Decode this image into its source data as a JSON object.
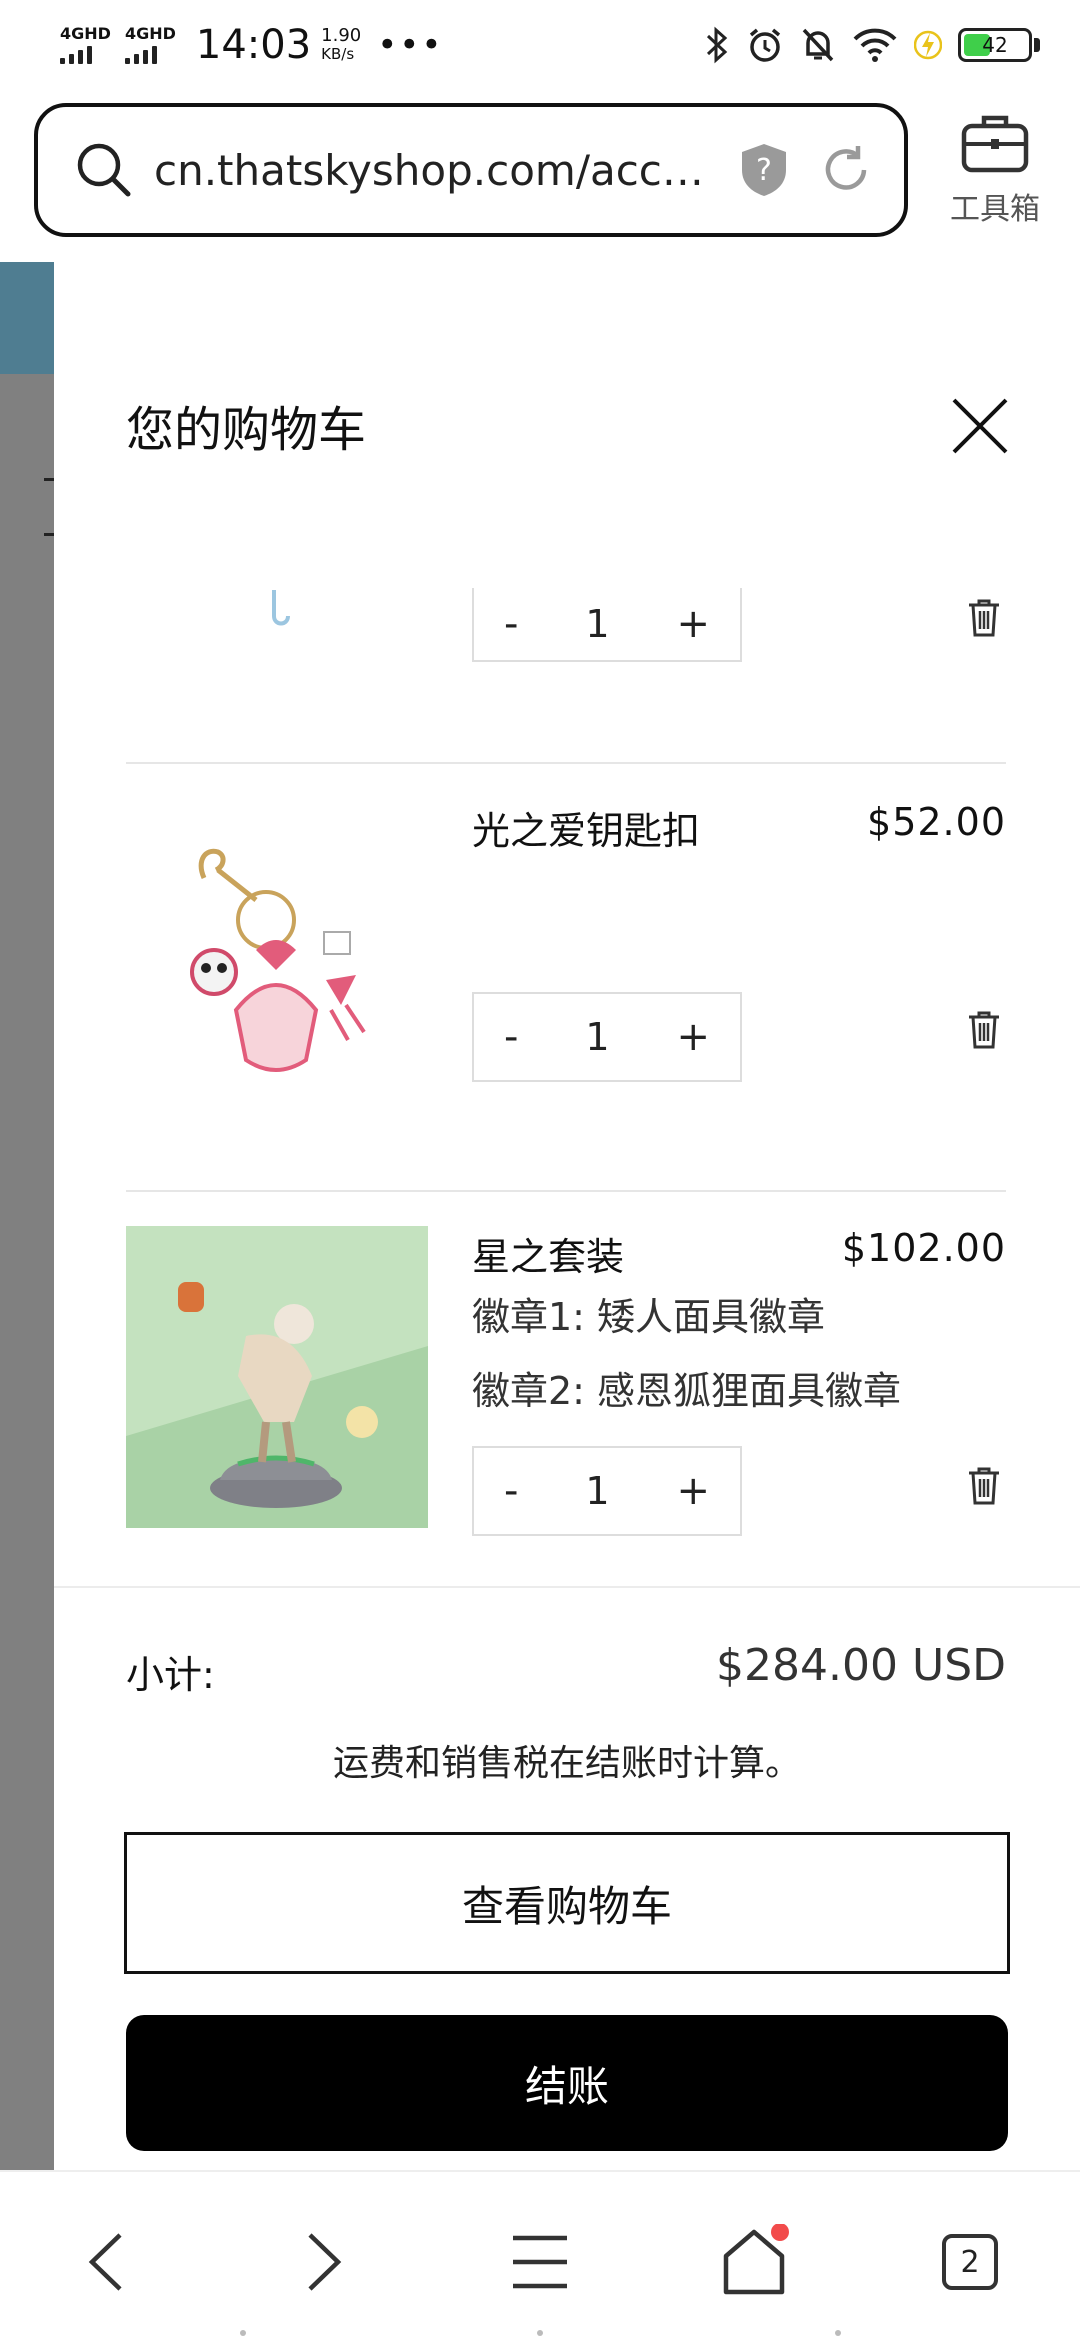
{
  "status_bar": {
    "sim1": "4GHD",
    "sim2": "4GHD",
    "time": "14:03",
    "net_speed_value": "1.90",
    "net_speed_unit": "KB/s",
    "more": "•••",
    "battery_level": "42",
    "icons": [
      "bluetooth-icon",
      "alarm-icon",
      "silent-icon",
      "wifi-icon",
      "charging-icon",
      "battery-icon"
    ]
  },
  "browser": {
    "url": "cn.thatskyshop.com/acc…",
    "toolbox_label": "工具箱"
  },
  "cart": {
    "title": "您的购物车",
    "items": [
      {
        "name": "",
        "price": "",
        "options": [],
        "quantity": "1"
      },
      {
        "name": "光之爱钥匙扣",
        "price": "$52.00",
        "options": [],
        "quantity": "1"
      },
      {
        "name": "星之套装",
        "price": "$102.00",
        "options": [
          "徽章1: 矮人面具徽章",
          "徽章2: 感恩狐狸面具徽章"
        ],
        "quantity": "1"
      }
    ],
    "minus": "-",
    "plus": "+",
    "subtotal_label": "小计:",
    "subtotal_value": "$284.00 USD",
    "tax_note": "运费和销售税在结账时计算。",
    "view_cart": "查看购物车",
    "checkout": "结账"
  },
  "bottom_nav": {
    "tab_count": "2",
    "icons": [
      "back-icon",
      "forward-icon",
      "menu-icon",
      "home-icon",
      "tabs-icon"
    ]
  },
  "colors": {
    "checkout_bg": "#000000",
    "battery_fill": "#3fcf4a",
    "notification_dot": "#f24b4b",
    "thumb_green": "#b9dcb6"
  }
}
